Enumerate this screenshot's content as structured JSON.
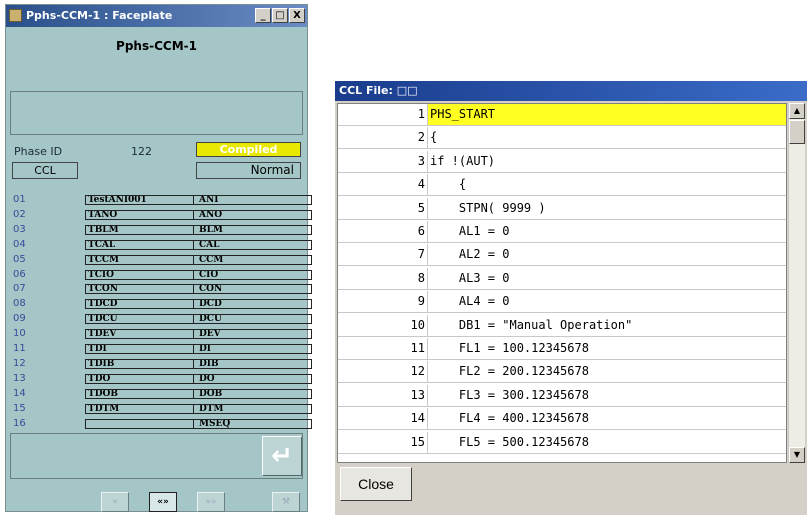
{
  "faceplate": {
    "window_title": "Pphs-CCM-1 : Faceplate",
    "window_buttons": {
      "minimize": "_",
      "maximize": "□",
      "close": "X"
    },
    "name": "Pphs-CCM-1",
    "phase_id_label": "Phase ID",
    "phase_id_value": "122",
    "compiled_status": "Compiled",
    "ccl_button": "CCL",
    "mode_status": "Normal",
    "rows": [
      {
        "num": "01",
        "tag": "TestANI001",
        "abbr": "ANI"
      },
      {
        "num": "02",
        "tag": "TANO",
        "abbr": "ANO"
      },
      {
        "num": "03",
        "tag": "TBLM",
        "abbr": "BLM"
      },
      {
        "num": "04",
        "tag": "TCAL",
        "abbr": "CAL"
      },
      {
        "num": "05",
        "tag": "TCCM",
        "abbr": "CCM"
      },
      {
        "num": "06",
        "tag": "TCIO",
        "abbr": "CIO"
      },
      {
        "num": "07",
        "tag": "TCON",
        "abbr": "CON"
      },
      {
        "num": "08",
        "tag": "TDCD",
        "abbr": "DCD"
      },
      {
        "num": "09",
        "tag": "TDCU",
        "abbr": "DCU"
      },
      {
        "num": "10",
        "tag": "TDEV",
        "abbr": "DEV"
      },
      {
        "num": "11",
        "tag": "TDI",
        "abbr": "DI"
      },
      {
        "num": "12",
        "tag": "TDIB",
        "abbr": "DIB"
      },
      {
        "num": "13",
        "tag": "TDO",
        "abbr": "DO"
      },
      {
        "num": "14",
        "tag": "TDOB",
        "abbr": "DOB"
      },
      {
        "num": "15",
        "tag": "TDTM",
        "abbr": "DTM"
      },
      {
        "num": "16",
        "tag": "",
        "abbr": "MSEQ"
      }
    ],
    "nav_buttons": {
      "prev": "«",
      "both": "«»",
      "next": "»»",
      "tool": "⚒"
    },
    "enter_icon": "enter-arrow-icon"
  },
  "ccl_window": {
    "title": "CCL File: □□",
    "scroll_up": "▲",
    "scroll_down": "▼",
    "lines": [
      {
        "n": "1",
        "code": "PHS_START"
      },
      {
        "n": "2",
        "code": "{"
      },
      {
        "n": "3",
        "code": "if !(AUT)"
      },
      {
        "n": "4",
        "code": "    {"
      },
      {
        "n": "5",
        "code": "    STPN( 9999 )"
      },
      {
        "n": "6",
        "code": "    AL1 = 0"
      },
      {
        "n": "7",
        "code": "    AL2 = 0"
      },
      {
        "n": "8",
        "code": "    AL3 = 0"
      },
      {
        "n": "9",
        "code": "    AL4 = 0"
      },
      {
        "n": "10",
        "code": "    DB1 = \"Manual Operation\""
      },
      {
        "n": "11",
        "code": "    FL1 = 100.12345678"
      },
      {
        "n": "12",
        "code": "    FL2 = 200.12345678"
      },
      {
        "n": "13",
        "code": "    FL3 = 300.12345678"
      },
      {
        "n": "14",
        "code": "    FL4 = 400.12345678"
      },
      {
        "n": "15",
        "code": "    FL5 = 500.12345678"
      }
    ],
    "highlight_line": 1,
    "close_button": "Close"
  }
}
